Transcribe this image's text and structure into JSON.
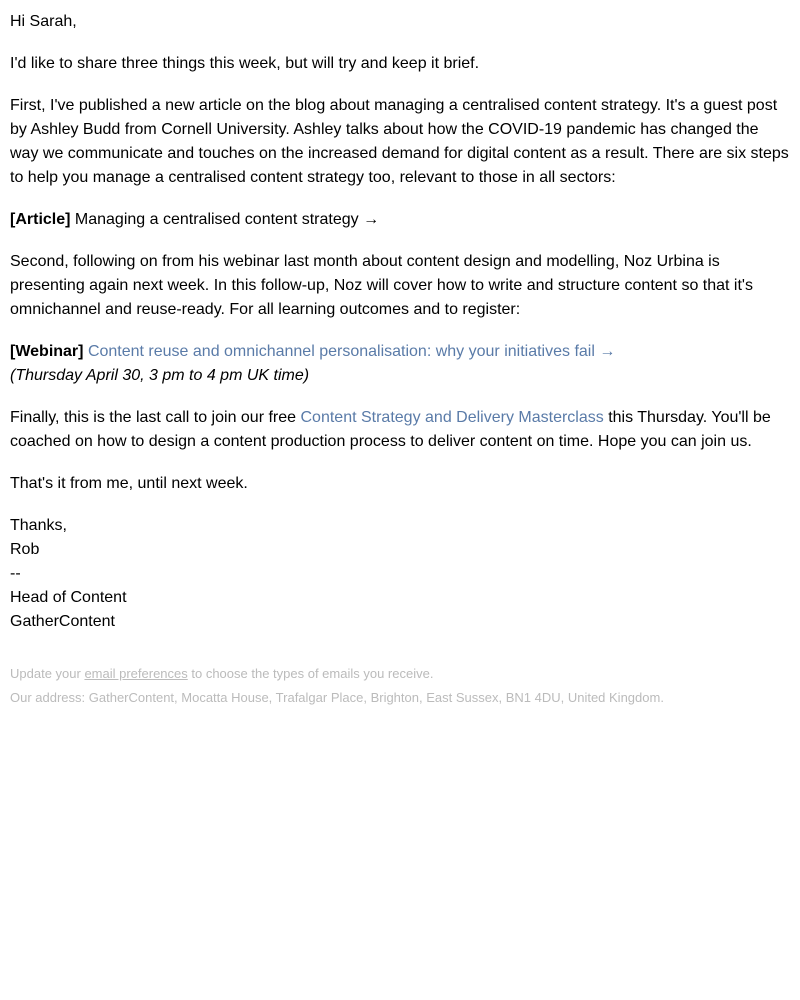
{
  "greeting": "Hi Sarah,",
  "intro": "I'd like to share three things this week, but will try and keep it brief.",
  "para1": "First, I've published a new article on the blog about managing a centralised content strategy. It's a guest post by Ashley Budd from Cornell University. Ashley talks about how the COVID-19 pandemic has changed the way we communicate and touches on the increased demand for digital content as a result. There are six steps to help you manage a centralised content strategy too, relevant to those in all sectors:",
  "article": {
    "label": "[Article]",
    "title": "Managing a centralised content strategy →"
  },
  "para2": "Second, following on from his webinar last month about content design and modelling, Noz Urbina is presenting again next week. In this follow-up, Noz will cover how to write and structure content so that it's omnichannel and reuse-ready. For all learning outcomes and to register:",
  "webinar": {
    "label": "[Webinar]",
    "title": "Content reuse and omnichannel personalisation: why your initiatives fail →",
    "time": "(Thursday April 30, 3 pm to 4 pm UK time)"
  },
  "para3": {
    "pre": "Finally, this is the last call to join our free ",
    "link": "Content Strategy and Delivery Masterclass",
    "post": " this Thursday. You'll be coached on how to design a content production process to deliver content on time. Hope you can join us."
  },
  "closing": "That's it from me, until next week.",
  "signature": {
    "thanks": "Thanks,",
    "name": "Rob",
    "divider": "--",
    "title": "Head of Content",
    "company": "GatherContent"
  },
  "footer": {
    "prefs_pre": "Update your ",
    "prefs_link": "email preferences",
    "prefs_post": " to choose the types of emails you receive.",
    "address": "Our address: GatherContent, Mocatta House, Trafalgar Place, Brighton, East Sussex, BN1 4DU, United Kingdom."
  }
}
